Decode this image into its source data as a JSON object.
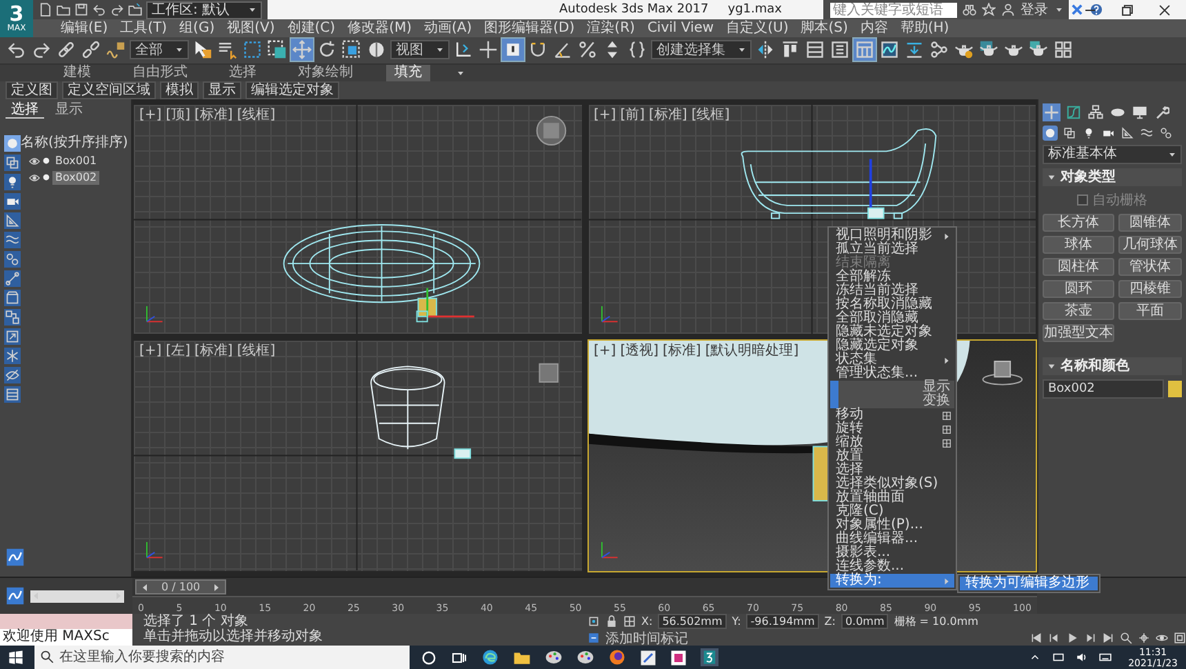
{
  "app": {
    "logo": "3",
    "logo_caption": "MAX",
    "workspace": "工作区: 默认",
    "title": "Autodesk 3ds Max 2017",
    "filename": "yg1.max",
    "search_placeholder": "键入关键字或短语",
    "sign_in": "登录"
  },
  "menu_bar": [
    "编辑(E)",
    "工具(T)",
    "组(G)",
    "视图(V)",
    "创建(C)",
    "修改器(M)",
    "动画(A)",
    "图形编辑器(D)",
    "渲染(R)",
    "Civil View",
    "自定义(U)",
    "脚本(S)",
    "内容",
    "帮助(H)"
  ],
  "main_toolbar": [
    {
      "kind": "undo",
      "selected": false
    },
    {
      "kind": "redo",
      "selected": false
    },
    {
      "kind": "link",
      "selected": false
    },
    {
      "kind": "unlink",
      "selected": false
    },
    {
      "kind": "bind",
      "selected": false
    },
    {
      "kind": "dropdown",
      "label": "全部",
      "selected": false
    },
    {
      "kind": "select",
      "selected": false
    },
    {
      "kind": "select_name",
      "selected": false
    },
    {
      "kind": "region",
      "selected": false
    },
    {
      "kind": "crossing",
      "selected": false
    },
    {
      "kind": "move",
      "selected": true
    },
    {
      "kind": "rotate",
      "selected": false
    },
    {
      "kind": "scale",
      "selected": false
    },
    {
      "kind": "place",
      "selected": false
    },
    {
      "kind": "dropdown",
      "label": "视图",
      "selected": false
    },
    {
      "kind": "pivot",
      "selected": false
    },
    {
      "kind": "manipulate",
      "selected": false
    },
    {
      "kind": "shortcut",
      "selected": true
    },
    {
      "kind": "snap",
      "selected": false
    },
    {
      "kind": "angle_snap",
      "selected": false
    },
    {
      "kind": "percent_snap",
      "selected": false
    },
    {
      "kind": "spinner_snap",
      "selected": false
    },
    {
      "kind": "named_sel",
      "selected": false
    },
    {
      "kind": "dropdown",
      "label": "创建选择集",
      "selected": false
    },
    {
      "kind": "mirror",
      "selected": false
    },
    {
      "kind": "align",
      "selected": false
    },
    {
      "kind": "layers",
      "selected": false
    },
    {
      "kind": "explorer",
      "selected": false
    },
    {
      "kind": "ribbon",
      "selected": true
    },
    {
      "kind": "curve",
      "selected": false
    },
    {
      "kind": "rule",
      "selected": false
    },
    {
      "kind": "schematic",
      "selected": false
    },
    {
      "kind": "material",
      "selected": false
    },
    {
      "kind": "render_setup",
      "selected": false
    },
    {
      "kind": "render_frame",
      "selected": false
    },
    {
      "kind": "render",
      "selected": false
    },
    {
      "kind": "viewport_grid",
      "selected": false
    }
  ],
  "ribbon": {
    "tabs": [
      {
        "label": "建模",
        "selected": false
      },
      {
        "label": "自由形式",
        "selected": false
      },
      {
        "label": "选择",
        "selected": false
      },
      {
        "label": "对象绘制",
        "selected": false
      },
      {
        "label": "填充",
        "selected": true
      }
    ],
    "panels": [
      "定义图",
      "定义空间区域",
      "模拟",
      "显示",
      "编辑选定对象"
    ]
  },
  "scene_explorer": {
    "tabs": [
      {
        "label": "选择",
        "selected": true
      },
      {
        "label": "显示",
        "selected": false
      }
    ],
    "column_header": "名称(按升序排序)",
    "filters": [
      {
        "kind": "geometry",
        "selected": true
      },
      {
        "kind": "shapes",
        "selected": false
      },
      {
        "kind": "lights",
        "selected": false
      },
      {
        "kind": "cameras",
        "selected": false
      },
      {
        "kind": "helpers",
        "selected": false
      },
      {
        "kind": "spacewarps",
        "selected": false
      },
      {
        "kind": "systems",
        "selected": false
      },
      {
        "kind": "bones",
        "selected": false
      },
      {
        "kind": "containers",
        "selected": false
      },
      {
        "kind": "groups",
        "selected": false
      },
      {
        "kind": "xrefs",
        "selected": false
      },
      {
        "kind": "frozen",
        "selected": false
      },
      {
        "kind": "hidden",
        "selected": false
      },
      {
        "kind": "layers",
        "selected": false
      }
    ],
    "items": [
      {
        "name": "Box001",
        "selected": false
      },
      {
        "name": "Box002",
        "selected": true
      }
    ]
  },
  "viewports": [
    {
      "kind": "top",
      "labels": [
        "[+]",
        "[顶]",
        "[标准]",
        "[线框]"
      ],
      "active": false
    },
    {
      "kind": "front",
      "labels": [
        "[+]",
        "[前]",
        "[标准]",
        "[线框]"
      ],
      "active": false
    },
    {
      "kind": "left",
      "labels": [
        "[+]",
        "[左]",
        "[标准]",
        "[线框]"
      ],
      "active": false
    },
    {
      "kind": "perspective",
      "labels": [
        "[+]",
        "[透视]",
        "[标准]",
        "[默认明暗处理]"
      ],
      "active": true
    }
  ],
  "context_menu": {
    "items": [
      {
        "kind": "item",
        "label": "视口照明和阴影",
        "submenu": true,
        "settings": false,
        "disabled": false,
        "selected": false
      },
      {
        "kind": "item",
        "label": "孤立当前选择",
        "submenu": false,
        "settings": false,
        "disabled": false,
        "selected": false
      },
      {
        "kind": "item",
        "label": "结束隔离",
        "submenu": false,
        "settings": false,
        "disabled": true,
        "selected": false
      },
      {
        "kind": "item",
        "label": "全部解冻",
        "submenu": false,
        "settings": false,
        "disabled": false,
        "selected": false
      },
      {
        "kind": "item",
        "label": "冻结当前选择",
        "submenu": false,
        "settings": false,
        "disabled": false,
        "selected": false
      },
      {
        "kind": "item",
        "label": "按名称取消隐藏",
        "submenu": false,
        "settings": false,
        "disabled": false,
        "selected": false
      },
      {
        "kind": "item",
        "label": "全部取消隐藏",
        "submenu": false,
        "settings": false,
        "disabled": false,
        "selected": false
      },
      {
        "kind": "item",
        "label": "隐藏未选定对象",
        "submenu": false,
        "settings": false,
        "disabled": false,
        "selected": false
      },
      {
        "kind": "item",
        "label": "隐藏选定对象",
        "submenu": false,
        "settings": false,
        "disabled": false,
        "selected": false
      },
      {
        "kind": "item",
        "label": "状态集",
        "submenu": true,
        "settings": false,
        "disabled": false,
        "selected": false
      },
      {
        "kind": "item",
        "label": "管理状态集...",
        "submenu": false,
        "settings": false,
        "disabled": false,
        "selected": false
      },
      {
        "kind": "header",
        "label": "显示"
      },
      {
        "kind": "header",
        "label": "变换"
      },
      {
        "kind": "item",
        "label": "移动",
        "submenu": false,
        "settings": true,
        "disabled": false,
        "selected": false
      },
      {
        "kind": "item",
        "label": "旋转",
        "submenu": false,
        "settings": true,
        "disabled": false,
        "selected": false
      },
      {
        "kind": "item",
        "label": "缩放",
        "submenu": false,
        "settings": true,
        "disabled": false,
        "selected": false
      },
      {
        "kind": "item",
        "label": "放置",
        "submenu": false,
        "settings": false,
        "disabled": false,
        "selected": false
      },
      {
        "kind": "item",
        "label": "选择",
        "submenu": false,
        "settings": false,
        "disabled": false,
        "selected": false
      },
      {
        "kind": "item",
        "label": "选择类似对象(S)",
        "submenu": false,
        "settings": false,
        "disabled": false,
        "selected": false
      },
      {
        "kind": "item",
        "label": "放置轴曲面",
        "submenu": false,
        "settings": false,
        "disabled": false,
        "selected": false
      },
      {
        "kind": "item",
        "label": "克隆(C)",
        "submenu": false,
        "settings": false,
        "disabled": false,
        "selected": false
      },
      {
        "kind": "item",
        "label": "对象属性(P)...",
        "submenu": false,
        "settings": false,
        "disabled": false,
        "selected": false
      },
      {
        "kind": "item",
        "label": "曲线编辑器...",
        "submenu": false,
        "settings": false,
        "disabled": false,
        "selected": false
      },
      {
        "kind": "item",
        "label": "摄影表...",
        "submenu": false,
        "settings": false,
        "disabled": false,
        "selected": false
      },
      {
        "kind": "item",
        "label": "连线参数...",
        "submenu": false,
        "settings": false,
        "disabled": false,
        "selected": false
      },
      {
        "kind": "item",
        "label": "转换为:",
        "submenu": true,
        "settings": false,
        "disabled": false,
        "selected": true
      }
    ],
    "submenu": [
      {
        "label": "转换为可编辑多边形",
        "selected": true
      }
    ]
  },
  "command_panel": {
    "tabs": [
      {
        "kind": "create",
        "selected": true
      },
      {
        "kind": "modify",
        "selected": false
      },
      {
        "kind": "hierarchy",
        "selected": false
      },
      {
        "kind": "motion",
        "selected": false
      },
      {
        "kind": "display",
        "selected": false
      },
      {
        "kind": "utilities",
        "selected": false
      }
    ],
    "categories": [
      {
        "kind": "geometry",
        "selected": true
      },
      {
        "kind": "shapes",
        "selected": false
      },
      {
        "kind": "lights",
        "selected": false
      },
      {
        "kind": "cameras",
        "selected": false
      },
      {
        "kind": "helpers",
        "selected": false
      },
      {
        "kind": "spacewarps",
        "selected": false
      },
      {
        "kind": "systems",
        "selected": false
      }
    ],
    "subcategory": "标准基本体",
    "object_type_title": "对象类型",
    "autogrid": {
      "label": "自动栅格",
      "checked": false
    },
    "object_buttons": [
      "长方体",
      "圆锥体",
      "球体",
      "几何球体",
      "圆柱体",
      "管状体",
      "圆环",
      "四棱锥",
      "茶壶",
      "平面",
      "加强型文本"
    ],
    "name_color_title": "名称和颜色",
    "object_name": "Box002"
  },
  "timeline": {
    "position": "0 / 100",
    "ticks": [
      "0",
      "5",
      "10",
      "15",
      "20",
      "25",
      "30",
      "35",
      "40",
      "45",
      "50",
      "55",
      "60",
      "65",
      "70",
      "75",
      "80",
      "85",
      "90",
      "95",
      "100"
    ]
  },
  "status_bar": {
    "listener": "欢迎使用 MAXSc",
    "selection": "选择了 1 个 对象",
    "prompt": "单击并拖动以选择并移动对象",
    "coordinates": [
      {
        "label": "X:",
        "value": "56.502mm"
      },
      {
        "label": "Y:",
        "value": "-96.194mm"
      },
      {
        "label": "Z:",
        "value": "0.0mm"
      }
    ],
    "grid": "栅格 = 10.0mm",
    "time_tag": "添加时间标记"
  },
  "taskbar": {
    "search_placeholder": "在这里输入你要搜索的内容",
    "time": "11:31",
    "date": "2021/1/23"
  }
}
